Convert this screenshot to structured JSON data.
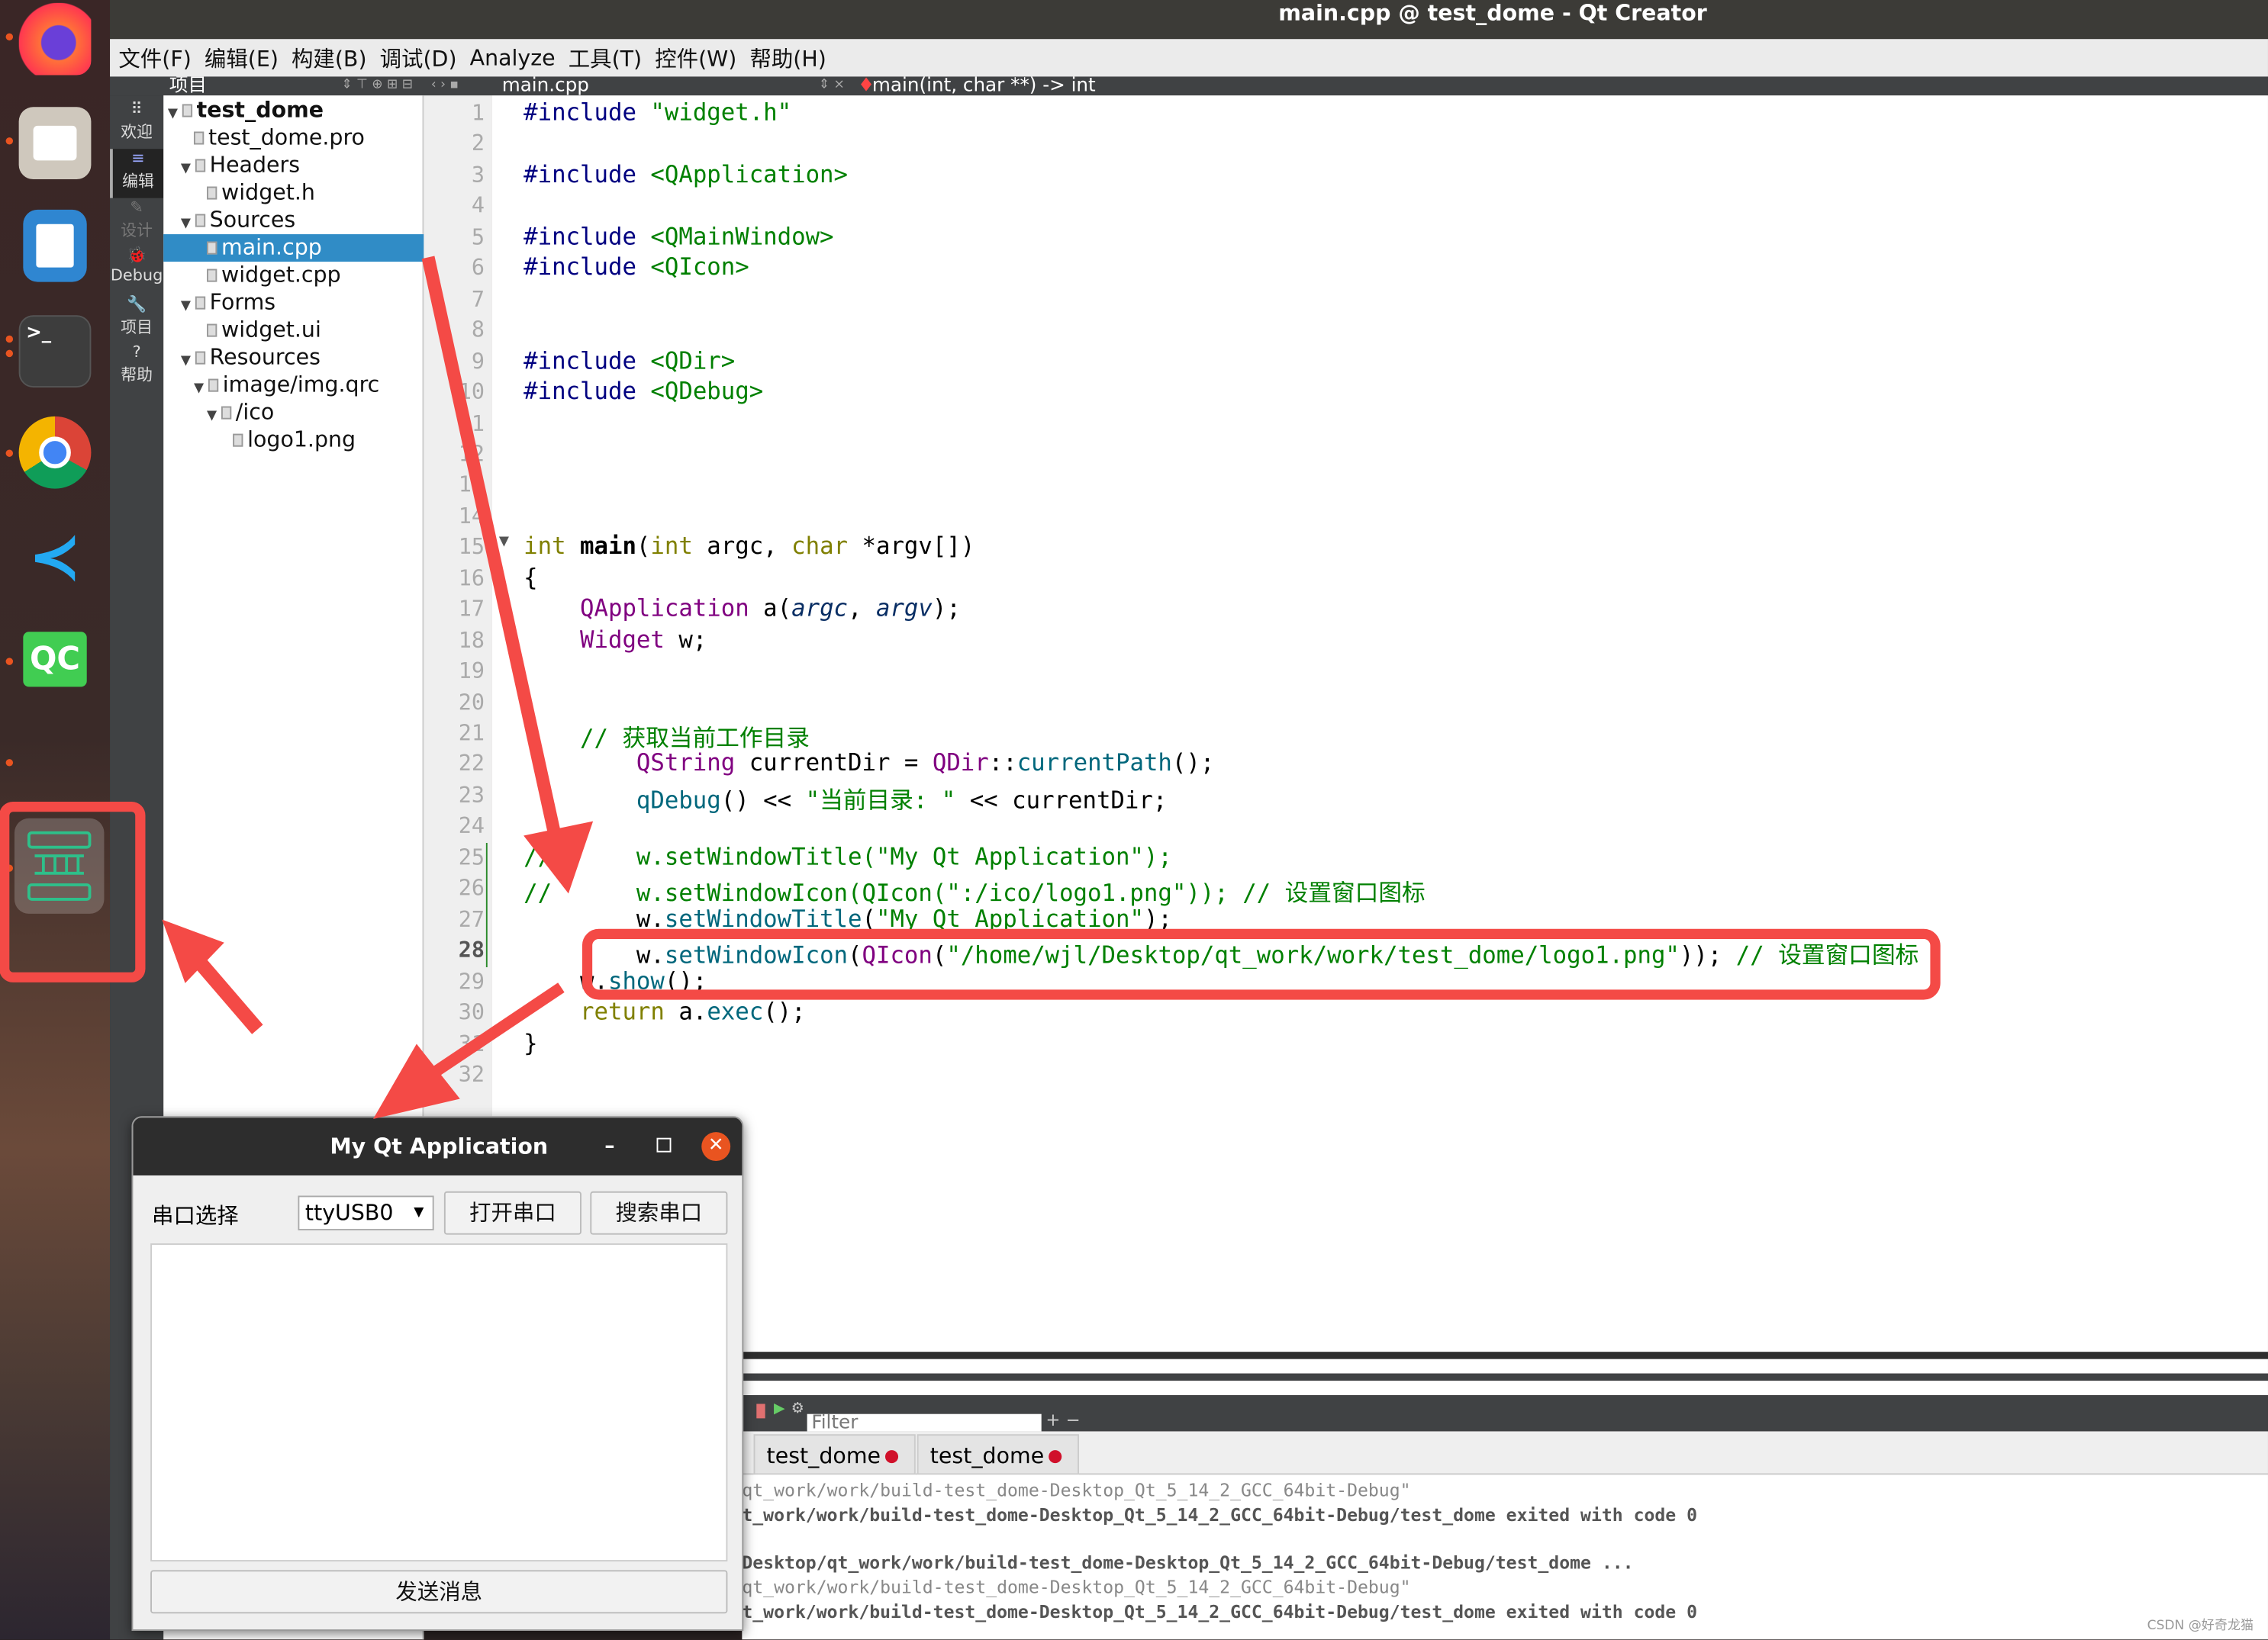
{
  "window": {
    "title": "main.cpp @ test_dome - Qt Creator"
  },
  "menubar": [
    "文件(F)",
    "编辑(E)",
    "构建(B)",
    "调试(D)",
    "Analyze",
    "工具(T)",
    "控件(W)",
    "帮助(H)"
  ],
  "toolbar": {
    "projects_label": "项目",
    "file_tab": "main.cpp",
    "function_crumb": "main(int, char **) -> int"
  },
  "modes": [
    "欢迎",
    "编辑",
    "设计",
    "Debug",
    "项目",
    "帮助"
  ],
  "tree": [
    {
      "label": "test_dome",
      "level": 0,
      "expanded": true,
      "bold": true
    },
    {
      "label": "test_dome.pro",
      "level": 1
    },
    {
      "label": "Headers",
      "level": 1,
      "expanded": true
    },
    {
      "label": "widget.h",
      "level": 2
    },
    {
      "label": "Sources",
      "level": 1,
      "expanded": true
    },
    {
      "label": "main.cpp",
      "level": 2,
      "selected": true
    },
    {
      "label": "widget.cpp",
      "level": 2
    },
    {
      "label": "Forms",
      "level": 1,
      "expanded": true
    },
    {
      "label": "widget.ui",
      "level": 2
    },
    {
      "label": "Resources",
      "level": 1,
      "expanded": true
    },
    {
      "label": "image/img.qrc",
      "level": 2,
      "expanded": true
    },
    {
      "label": "/ico",
      "level": 3,
      "expanded": true
    },
    {
      "label": "logo1.png",
      "level": 4
    }
  ],
  "editor": {
    "current_line": 28,
    "lines": [
      [
        [
          "#include ",
          "pp"
        ],
        [
          "\"widget.h\"",
          "s"
        ]
      ],
      [],
      [
        [
          "#include ",
          "pp"
        ],
        [
          "<QApplication>",
          "s"
        ]
      ],
      [],
      [
        [
          "#include ",
          "pp"
        ],
        [
          "<QMainWindow>",
          "s"
        ]
      ],
      [
        [
          "#include ",
          "pp"
        ],
        [
          "<QIcon>",
          "s"
        ]
      ],
      [],
      [],
      [
        [
          "#include ",
          "pp"
        ],
        [
          "<QDir>",
          "s"
        ]
      ],
      [
        [
          "#include ",
          "pp"
        ],
        [
          "<QDebug>",
          "s"
        ]
      ],
      [],
      [],
      [],
      [],
      [
        [
          "int ",
          "k"
        ],
        [
          "main",
          "b"
        ],
        [
          "(",
          ""
        ],
        [
          "int ",
          "k"
        ],
        [
          "argc, ",
          ""
        ],
        [
          "char ",
          "k"
        ],
        [
          "*argv[])",
          ""
        ]
      ],
      [
        [
          "{",
          ""
        ]
      ],
      [
        [
          "    ",
          ""
        ],
        [
          "QApplication ",
          "t"
        ],
        [
          "a(",
          ""
        ],
        [
          "argc",
          "i"
        ],
        [
          ", ",
          ""
        ],
        [
          "argv",
          "i"
        ],
        [
          ");",
          ""
        ]
      ],
      [
        [
          "    ",
          ""
        ],
        [
          "Widget ",
          "t"
        ],
        [
          "w;",
          ""
        ]
      ],
      [],
      [],
      [
        [
          "    ",
          ""
        ],
        [
          "// 获取当前工作目录",
          "c"
        ]
      ],
      [
        [
          "        ",
          ""
        ],
        [
          "QString ",
          "t"
        ],
        [
          "currentDir = ",
          ""
        ],
        [
          "QDir",
          "t"
        ],
        [
          "::",
          ""
        ],
        [
          "currentPath",
          "f"
        ],
        [
          "();",
          ""
        ]
      ],
      [
        [
          "        ",
          ""
        ],
        [
          "qDebug",
          "f"
        ],
        [
          "() << ",
          ""
        ],
        [
          "\"当前目录: \"",
          "s"
        ],
        [
          " << currentDir;",
          ""
        ]
      ],
      [],
      [
        [
          "//      w.setWindowTitle(\"My Qt Application\");",
          "c"
        ]
      ],
      [
        [
          "//      w.setWindowIcon(QIcon(\":/ico/logo1.png\")); // 设置窗口图标",
          "c"
        ]
      ],
      [
        [
          "        w.",
          ""
        ],
        [
          "setWindowTitle",
          "f"
        ],
        [
          "(",
          ""
        ],
        [
          "\"My Qt Application\"",
          "s"
        ],
        [
          ");",
          ""
        ]
      ],
      [
        [
          "        w.",
          ""
        ],
        [
          "setWindowIcon",
          "f"
        ],
        [
          "(",
          ""
        ],
        [
          "QIcon",
          "t"
        ],
        [
          "(",
          ""
        ],
        [
          "\"/home/wjl/Desktop/qt_work/work/test_dome/logo1.png\"",
          "s"
        ],
        [
          ")); ",
          ""
        ],
        [
          "// 设置窗口图标",
          "c"
        ]
      ],
      [
        [
          "    w.",
          ""
        ],
        [
          "show",
          "f"
        ],
        [
          "();",
          ""
        ]
      ],
      [
        [
          "    ",
          ""
        ],
        [
          "return ",
          "k"
        ],
        [
          "a.",
          ""
        ],
        [
          "exec",
          "f"
        ],
        [
          "();",
          ""
        ]
      ],
      [
        [
          "}",
          ""
        ]
      ],
      []
    ]
  },
  "output_panel": {
    "filter_placeholder": "Filter",
    "tabs": [
      "test_dome",
      "test_dome"
    ],
    "lines": [
      {
        "text": "qt_work/work/build-test_dome-Desktop_Qt_5_14_2_GCC_64bit-Debug\"",
        "bold": false
      },
      {
        "text": "t_work/work/build-test_dome-Desktop_Qt_5_14_2_GCC_64bit-Debug/test_dome exited with code 0",
        "bold": true
      },
      {
        "text": "",
        "bold": false
      },
      {
        "text": "Desktop/qt_work/work/build-test_dome-Desktop_Qt_5_14_2_GCC_64bit-Debug/test_dome ...",
        "bold": true
      },
      {
        "text": "qt_work/work/build-test_dome-Desktop_Qt_5_14_2_GCC_64bit-Debug\"",
        "bold": false
      },
      {
        "text": "t_work/work/build-test_dome-Desktop_Qt_5_14_2_GCC_64bit-Debug/test_dome exited with code 0",
        "bold": true
      }
    ]
  },
  "dialog": {
    "title": "My Qt Application",
    "port_label": "串口选择",
    "port_value": "ttyUSB0",
    "open_button": "打开串口",
    "search_button": "搜索串口",
    "send_button": "发送消息"
  },
  "dock": [
    "firefox-icon",
    "files-icon",
    "writer-icon",
    "terminal-icon",
    "chrome-icon",
    "vscode-icon",
    "qtcreator-icon",
    "serial-app-icon"
  ],
  "colors": {
    "annotation": "#f44a46",
    "selection": "#308cc6",
    "qt_green": "#41cd52"
  },
  "watermark": "CSDN @好奇龙猫"
}
